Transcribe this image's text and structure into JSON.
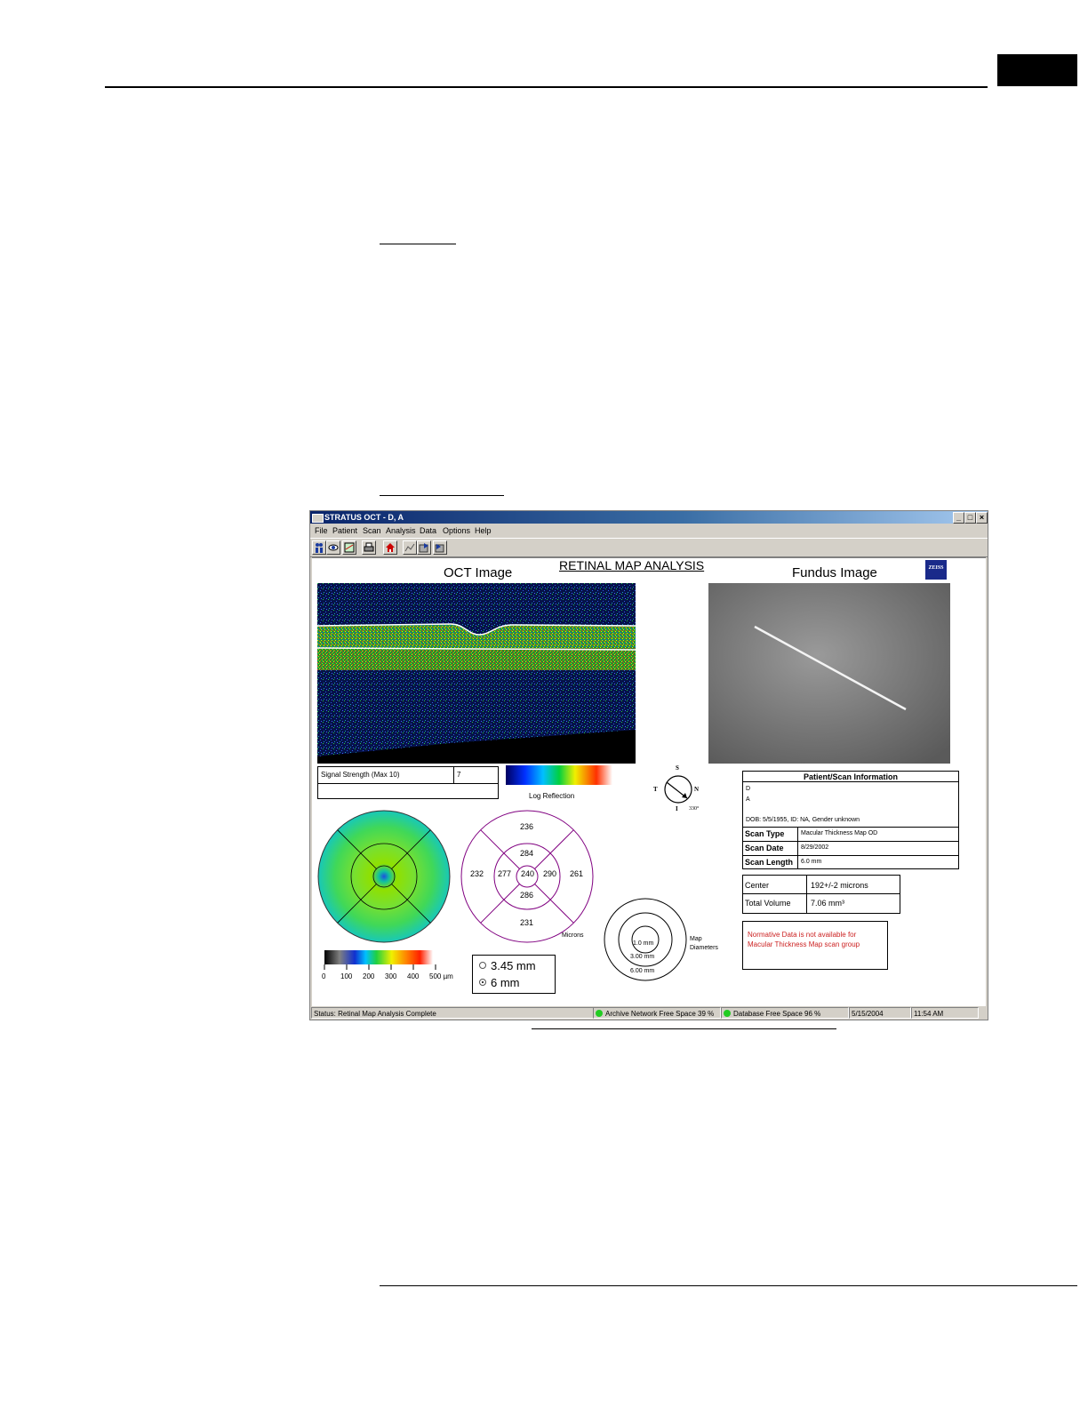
{
  "window": {
    "title": "STRATUS OCT - D, A",
    "controls": [
      "_",
      "□",
      "×"
    ]
  },
  "menu": [
    "File",
    "Patient",
    "Scan",
    "Analysis",
    "Data",
    "Options",
    "Help"
  ],
  "toolbar_icons": [
    "patients-icon",
    "eye-icon",
    "scan-icon",
    "print-icon",
    "home-icon",
    "analysis-icon",
    "export-icon",
    "import-icon"
  ],
  "report": {
    "title": "RETINAL MAP ANALYSIS",
    "oct_heading": "OCT Image",
    "fundus_heading": "Fundus Image",
    "logo": "ZEISS",
    "signal_label": "Signal Strength (Max 10)",
    "signal_value": "7",
    "log_reflection": "Log Reflection",
    "compass": {
      "s": "S",
      "t": "T",
      "n": "N",
      "i": "I",
      "angle": "330°"
    },
    "thickness_map": {
      "outer_superior": "236",
      "inner_superior": "284",
      "outer_temporal": "232",
      "inner_temporal": "277",
      "center": "240",
      "inner_nasal": "290",
      "outer_nasal": "261",
      "inner_inferior": "286",
      "outer_inferior": "231",
      "units": "Microns"
    },
    "scale_ticks": [
      "0",
      "100",
      "200",
      "300",
      "400",
      "500 µm"
    ],
    "diameter_options": [
      {
        "label": "3.45 mm",
        "selected": false
      },
      {
        "label": "6 mm",
        "selected": true
      }
    ],
    "map_diameters": {
      "label_1": "Map",
      "label_2": "Diameters",
      "inner": "1.0 mm",
      "middle": "3.00 mm",
      "outer": "6.00 mm"
    },
    "patient_info": {
      "heading": "Patient/Scan Information",
      "line1": "D",
      "line2": "A",
      "dob": "DOB: 5/5/1955, ID: NA, Gender unknown",
      "rows": [
        {
          "label": "Scan Type",
          "value": "Macular Thickness Map OD"
        },
        {
          "label": "Scan Date",
          "value": "8/29/2002"
        },
        {
          "label": "Scan Length",
          "value": "6.0 mm"
        }
      ]
    },
    "metrics": [
      {
        "label": "Center",
        "value": "192+/-2 microns"
      },
      {
        "label": "Total Volume",
        "value": "7.06 mm³"
      }
    ],
    "normative_note": "Normative Data is not available for Macular Thickness Map scan group"
  },
  "status": {
    "text": "Status: Retinal Map Analysis Complete",
    "archive": "Archive Network Free Space 39 %",
    "database": "Database Free Space 96 %",
    "date": "5/15/2004",
    "time": "11:54 AM"
  },
  "colors": {
    "titlebar": "#0a246a",
    "status_ok": "#22cc22",
    "note_text": "#cc2222",
    "map_ring": "#800080"
  }
}
